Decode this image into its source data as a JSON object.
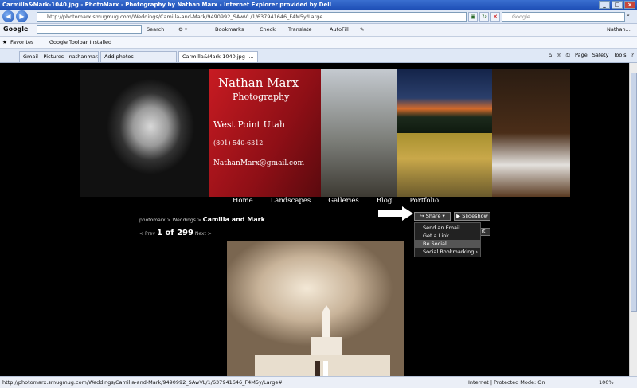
{
  "window": {
    "title": "Carmilla&Mark-1040.jpg - PhotoMarx - Photography by Nathan Marx - Internet Explorer provided by Dell"
  },
  "address": {
    "url": "http://photomarx.smugmug.com/Weddings/Camilla-and-Mark/9490992_SAwVL/1/637941646_F4M5y/Large",
    "search_placeholder": "Google"
  },
  "google_toolbar": {
    "logo": "Google",
    "search": "Search",
    "bookmarks": "Bookmarks",
    "check": "Check",
    "translate": "Translate",
    "autofill": "AutoFill",
    "account": "Nathan..."
  },
  "favorites": {
    "label": "Favorites",
    "items": [
      "Google Toolbar Installed"
    ]
  },
  "tabs": [
    {
      "label": "Gmail - Pictures - nathanmar..."
    },
    {
      "label": "Add photos"
    },
    {
      "label": "Carmilla&Mark-1040.jpg -..."
    }
  ],
  "command_bar": {
    "page": "Page",
    "safety": "Safety",
    "tools": "Tools"
  },
  "banner": {
    "name": "Nathan Marx",
    "subtitle": "Photography",
    "city": "West Point Utah",
    "phone": "(801) 540-6312",
    "email": "NathanMarx@gmail.com"
  },
  "site_nav": [
    "Home",
    "Landscapes",
    "Galleries",
    "Blog",
    "Portfolio"
  ],
  "breadcrumb": {
    "root": "photomarx",
    "section": "Weddings",
    "current": "Camilla and Mark"
  },
  "pager": {
    "prev": "Prev",
    "current": "1 of 299",
    "next": "Next"
  },
  "buttons": {
    "share": "Share",
    "slideshow": "Slideshow",
    "hidden_label": "rt"
  },
  "share_menu": {
    "items": [
      "Send an Email",
      "Get a Link",
      "Be Social",
      "Social Bookmarking"
    ],
    "highlighted_index": 2
  },
  "status": {
    "url": "http://photomarx.smugmug.com/Weddings/Camilla-and-Mark/9490992_SAwVL/1/637941646_F4M5y/Large#",
    "zone": "Internet | Protected Mode: On",
    "zoom": "100%"
  },
  "colors": {
    "accent_red": "#c81b22",
    "page_bg": "#000000"
  }
}
